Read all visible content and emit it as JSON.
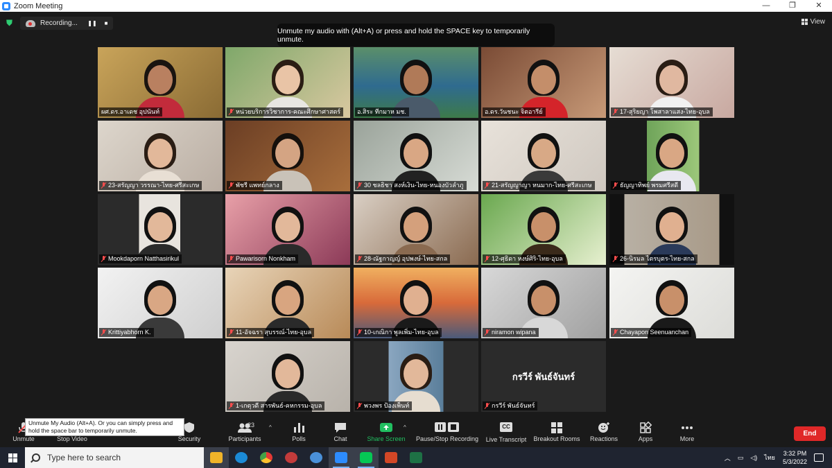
{
  "window": {
    "title": "Zoom Meeting",
    "min": "—",
    "max": "❐",
    "close": "✕"
  },
  "recording": {
    "label": "Recording...",
    "pause": "❚❚",
    "stop": "■"
  },
  "view": {
    "label": "View"
  },
  "notice": {
    "text": "Unmute my audio with (Alt+A) or press and hold the SPACE key to temporarily unmute."
  },
  "tiles": [
    {
      "name": "ผศ.ดร.อาเดช อุปนันท์",
      "muted": false
    },
    {
      "name": "หน่วยบริการวิชาการ-คณะศึกษาศาสตร์",
      "muted": true
    },
    {
      "name": "อ.สิระ ทีกมาห มช.",
      "muted": false
    },
    {
      "name": "อ.ดร.วันชนะ จิตอารีย์",
      "muted": false
    },
    {
      "name": "17-สุริยญา โพสาลาแสง-ไทย-อุบล",
      "muted": true
    },
    {
      "name": "23-สรัญญา วรรณา-ไทย-ศรีสะเกษ",
      "muted": true
    },
    {
      "name": "พัชรี แพทย์กลาง",
      "muted": true
    },
    {
      "name": "30 ชลธิชา สงห์เงิน-ไทย-หนองบัวลำภู",
      "muted": true
    },
    {
      "name": "21-สรัญญาญา หนมาก-ไทย-ศรีสะเกษ",
      "muted": true
    },
    {
      "name": "ธัญญาทิพย์ พรมศรีสดี",
      "muted": true
    },
    {
      "name": "Mookdaporn Natthasirikul",
      "muted": true
    },
    {
      "name": "Pawarisorn Nonkham",
      "muted": true
    },
    {
      "name": "28-ณัฐกาญญ์ อุปพงษ์-ไทย-สกล",
      "muted": true
    },
    {
      "name": "12-ศุธิดา หงษ์ศิริ-ไทย-อุบล",
      "muted": true
    },
    {
      "name": "26-นิรมล ไตรบุตร-ไทย-สกล",
      "muted": true
    },
    {
      "name": "Krittiyabhorn K.",
      "muted": true
    },
    {
      "name": "11-อัจฉรา สุบรรณ์-ไทย-อุบล",
      "muted": true
    },
    {
      "name": "10-เกณิกา พูลเพิ่ม-ไทย-อุบล",
      "muted": true
    },
    {
      "name": "niramon wipana",
      "muted": true
    },
    {
      "name": "Chayapon Seenuanchan",
      "muted": true
    },
    {
      "name": "1-เกตุวดี สารพันธ์-คหกรรม-อุบล",
      "muted": true
    },
    {
      "name": "พวงพร ป้องเพ็นท์",
      "muted": true
    },
    {
      "name": "กรวีร์ พันธ์จันทร์",
      "muted": true
    }
  ],
  "nameonly_tile": {
    "display_name": "กรวีร์ พันธ์จันทร์"
  },
  "toolbar": {
    "unmute": "Unmute",
    "stop_video": "Stop Video",
    "security": "Security",
    "participants": "Participants",
    "participants_count": "23",
    "polls": "Polls",
    "chat": "Chat",
    "share_screen": "Share Screen",
    "pause_stop_recording": "Pause/Stop Recording",
    "live_transcript": "Live Transcript",
    "cc": "CC",
    "breakout_rooms": "Breakout Rooms",
    "reactions": "Reactions",
    "apps": "Apps",
    "more": "More",
    "end": "End",
    "caret": "^"
  },
  "tooltip": {
    "text": "Unmute My Audio (Alt+A). Or you can simply press and hold the space bar to temporarily unmute."
  },
  "taskbar": {
    "search_placeholder": "Type here to search",
    "language": "ไทย",
    "time": "3:32 PM",
    "date": "5/3/2022"
  },
  "colors": {
    "accent": "#2d8cff",
    "end": "#e02828",
    "share": "#21c061",
    "active_speaker": "#f3df5a"
  }
}
